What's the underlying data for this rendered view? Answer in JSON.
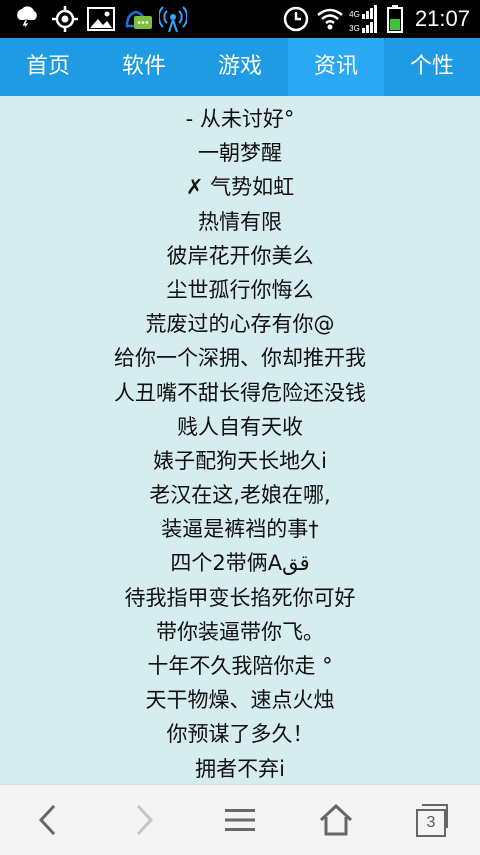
{
  "status_bar": {
    "time": "21:07",
    "signal_label_top": "4G",
    "signal_label_bottom": "3G"
  },
  "tabs": [
    {
      "label": "首页"
    },
    {
      "label": "软件"
    },
    {
      "label": "游戏"
    },
    {
      "label": "资讯",
      "active": true
    },
    {
      "label": "个性"
    }
  ],
  "content": {
    "lines": [
      "- 从未讨好°",
      "一朝梦醒",
      "✗ 气势如虹",
      "热情有限",
      "彼岸花开你美么",
      "尘世孤行你悔么",
      "荒废过的心存有你@",
      "给你一个深拥、你却推开我",
      "人丑嘴不甜长得危险还没钱",
      "贱人自有天收",
      "婊子配狗天长地久i",
      "老汉在这,老娘在哪,",
      "装逼是裤裆的事†",
      "四个2带俩Aقق",
      "待我指甲变长掐死你可好",
      "带你装逼带你飞。",
      "十年不久我陪你走 °",
      "天干物燥、速点火烛",
      "你预谋了多久！",
      "拥者不弃i"
    ]
  },
  "bottom_nav": {
    "tab_count": "3"
  },
  "colors": {
    "tabbar": "#1f9be3",
    "tab_active": "#2ba9f5",
    "content_bg": "#d6edf0"
  }
}
